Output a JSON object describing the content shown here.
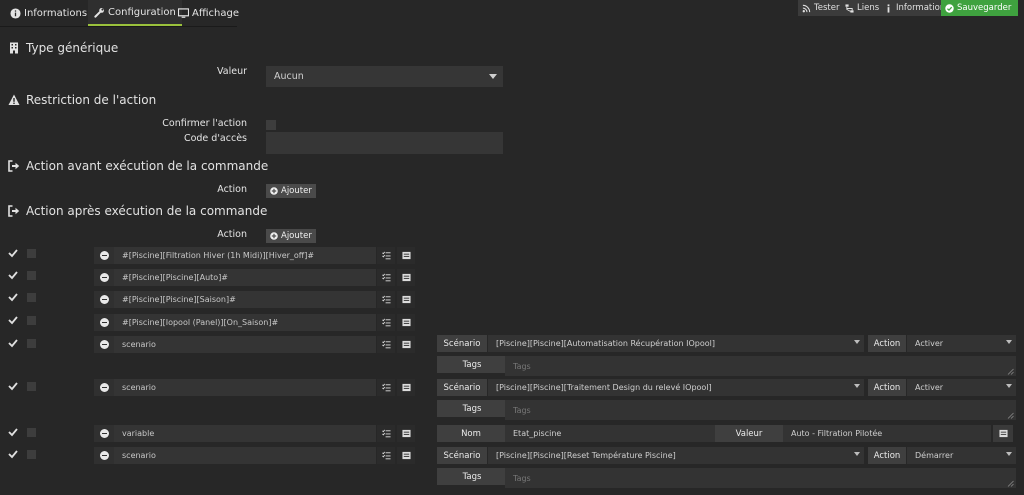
{
  "tabs": [
    {
      "label": "Informations",
      "icon": "info-circle-icon"
    },
    {
      "label": "Configuration",
      "icon": "wrench-icon"
    },
    {
      "label": "Affichage",
      "icon": "monitor-icon"
    }
  ],
  "toolbar": {
    "tester": "Tester",
    "liens": "Liens",
    "informations": "Informations",
    "sauvegarder": "Sauvegarder"
  },
  "colors": {
    "accent": "#9ac13c",
    "save": "#3fa23f",
    "background": "#272727"
  },
  "sections": {
    "type_generique": "Type générique",
    "restriction": "Restriction de l'action",
    "avant": "Action avant exécution de la commande",
    "apres": "Action après exécution de la commande"
  },
  "type_generique": {
    "valeur_label": "Valeur",
    "valeur": "Aucun"
  },
  "restriction": {
    "confirmer_label": "Confirmer l'action",
    "code_label": "Code d'accès",
    "code_value": ""
  },
  "avant": {
    "action_label": "Action",
    "add_label": "Ajouter"
  },
  "apres": {
    "action_label": "Action",
    "add_label": "Ajouter"
  },
  "actions": [
    {
      "command": "#[Piscine][Filtration Hiver (1h Midi)][Hiver_off]#"
    },
    {
      "command": "#[Piscine][Piscine][Auto]#"
    },
    {
      "command": "#[Piscine][Piscine][Saison]#"
    },
    {
      "command": "#[Piscine][Iopool (Panel)][On_Saison]#"
    },
    {
      "command": "scenario",
      "scenario_label": "Scénario",
      "scenario": "[Piscine][Piscine][Automatisation Récupération IOpool]",
      "action_label": "Action",
      "action": "Activer",
      "tags_label": "Tags",
      "tags_placeholder": "Tags"
    },
    {
      "command": "scenario",
      "scenario_label": "Scénario",
      "scenario": "[Piscine][Piscine][Traitement Design du relevé IOpool]",
      "action_label": "Action",
      "action": "Activer",
      "tags_label": "Tags",
      "tags_placeholder": "Tags"
    },
    {
      "command": "variable",
      "nom_label": "Nom",
      "nom": "Etat_piscine",
      "valeur_label": "Valeur",
      "valeur": "Auto - Filtration Pilotée"
    },
    {
      "command": "scenario",
      "scenario_label": "Scénario",
      "scenario": "[Piscine][Piscine][Reset Température Piscine]",
      "action_label": "Action",
      "action": "Démarrer",
      "tags_label": "Tags",
      "tags_placeholder": "Tags"
    }
  ]
}
